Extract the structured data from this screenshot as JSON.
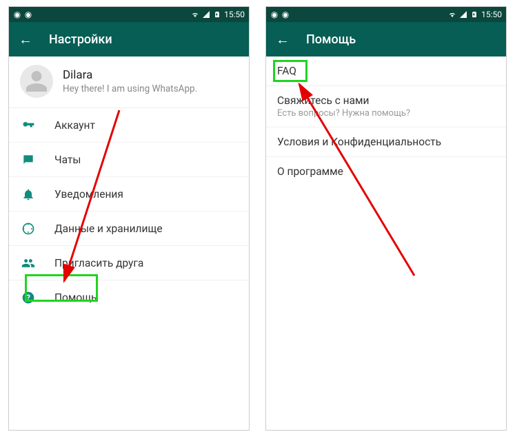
{
  "statusbar": {
    "time": "15:50"
  },
  "left": {
    "title": "Настройки",
    "profile": {
      "name": "Dilara",
      "status": "Hey there! I am using WhatsApp."
    },
    "menu": [
      {
        "icon": "key-icon",
        "label": "Аккаунт"
      },
      {
        "icon": "chat-icon",
        "label": "Чаты"
      },
      {
        "icon": "bell-icon",
        "label": "Уведомления"
      },
      {
        "icon": "data-icon",
        "label": "Данные и хранилище"
      },
      {
        "icon": "invite-icon",
        "label": "Пригласить друга"
      },
      {
        "icon": "help-icon",
        "label": "Помощь"
      }
    ]
  },
  "right": {
    "title": "Помощь",
    "items": [
      {
        "title": "FAQ",
        "sub": ""
      },
      {
        "title": "Свяжитесь с нами",
        "sub": "Есть вопросы? Нужна помощь?"
      },
      {
        "title": "Условия и Конфиденциальность",
        "sub": ""
      },
      {
        "title": "О программе",
        "sub": ""
      }
    ]
  }
}
